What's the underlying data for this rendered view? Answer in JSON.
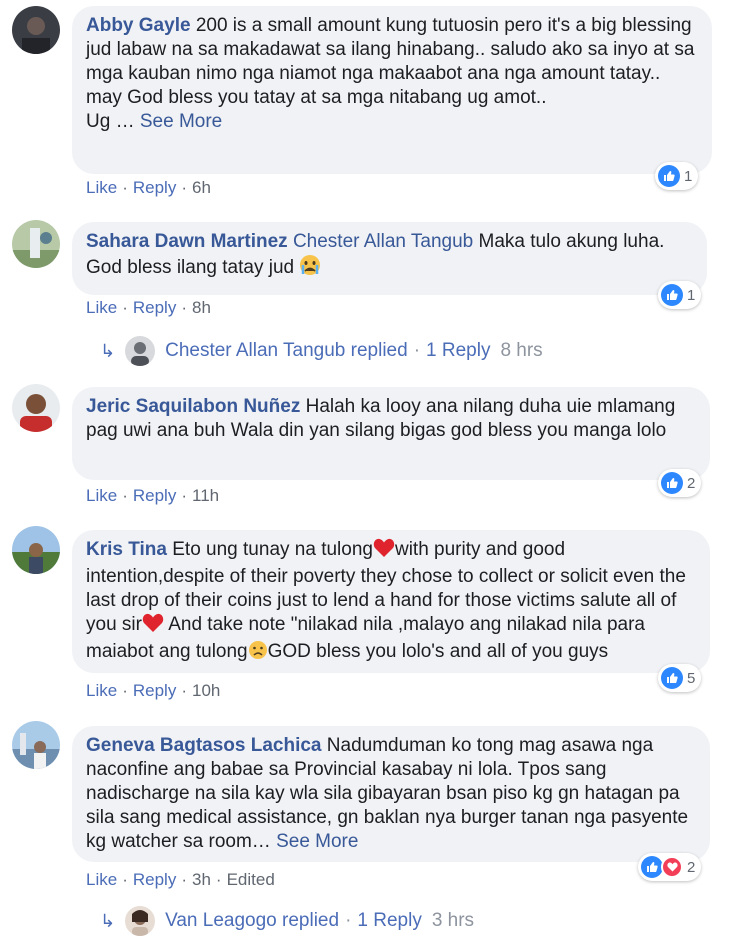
{
  "colors": {
    "link": "#385898",
    "bubble": "#f0f2f5",
    "like": "#2d88ff",
    "love": "#f33e58"
  },
  "comments": [
    {
      "author": "Abby Gayle",
      "text": "200 is a small amount kung tutuosin pero it's a big blessing jud labaw na sa makadawat sa ilang hinabang.. saludo ako sa inyo at sa mga kauban nimo nga niamot nga makaabot ana nga amount tatay.. may God bless you tatay at sa mga nitabang ug amot..",
      "text2": "Ug …",
      "see_more": "See More",
      "like": "Like",
      "reply": "Reply",
      "time": "6h",
      "reactions": "1"
    },
    {
      "author": "Sahara Dawn Martinez",
      "tag": "Chester Allan Tangub",
      "text": "Maka tulo akung luha. God bless ilang tatay jud",
      "emoji": "crying-face-emoji",
      "like": "Like",
      "reply": "Reply",
      "time": "8h",
      "reactions": "1",
      "replies": {
        "name": "Chester Allan Tangub replied",
        "count": "1 Reply",
        "time": "8 hrs"
      }
    },
    {
      "author": "Jeric Saquilabon Nuñez",
      "text": "Halah ka looy ana nilang duha uie mlamang pag uwi ana buh Wala din yan silang bigas god bless you manga lolo",
      "like": "Like",
      "reply": "Reply",
      "time": "11h",
      "reactions": "2"
    },
    {
      "author": "Kris Tina",
      "text_a": "Eto ung tunay na tulong",
      "text_b": "with purity and good intention,despite of their poverty they chose to collect or solicit even the last drop of their coins just to lend a hand for those victims salute all of you sir",
      "text_c": " And take note \"nilakad nila ,malayo ang nilakad nila para maiabot ang tulong",
      "text_d": "GOD bless you lolo's and all of you guys",
      "like": "Like",
      "reply": "Reply",
      "time": "10h",
      "reactions": "5"
    },
    {
      "author": "Geneva Bagtasos Lachica",
      "text": "Nadumduman ko tong mag asawa nga naconfine ang babae sa Provincial kasabay ni lola. Tpos sang nadischarge na sila kay wla sila gibayaran bsan piso kg gn hatagan pa sila sang medical assistance, gn baklan nya burger tanan nga pasyente kg watcher sa room…",
      "see_more": "See More",
      "like": "Like",
      "reply": "Reply",
      "time": "3h",
      "edited": "Edited",
      "reactions": "2",
      "replies": {
        "name": "Van Leagogo replied",
        "count": "1 Reply",
        "time": "3 hrs"
      }
    }
  ],
  "sep": "·"
}
